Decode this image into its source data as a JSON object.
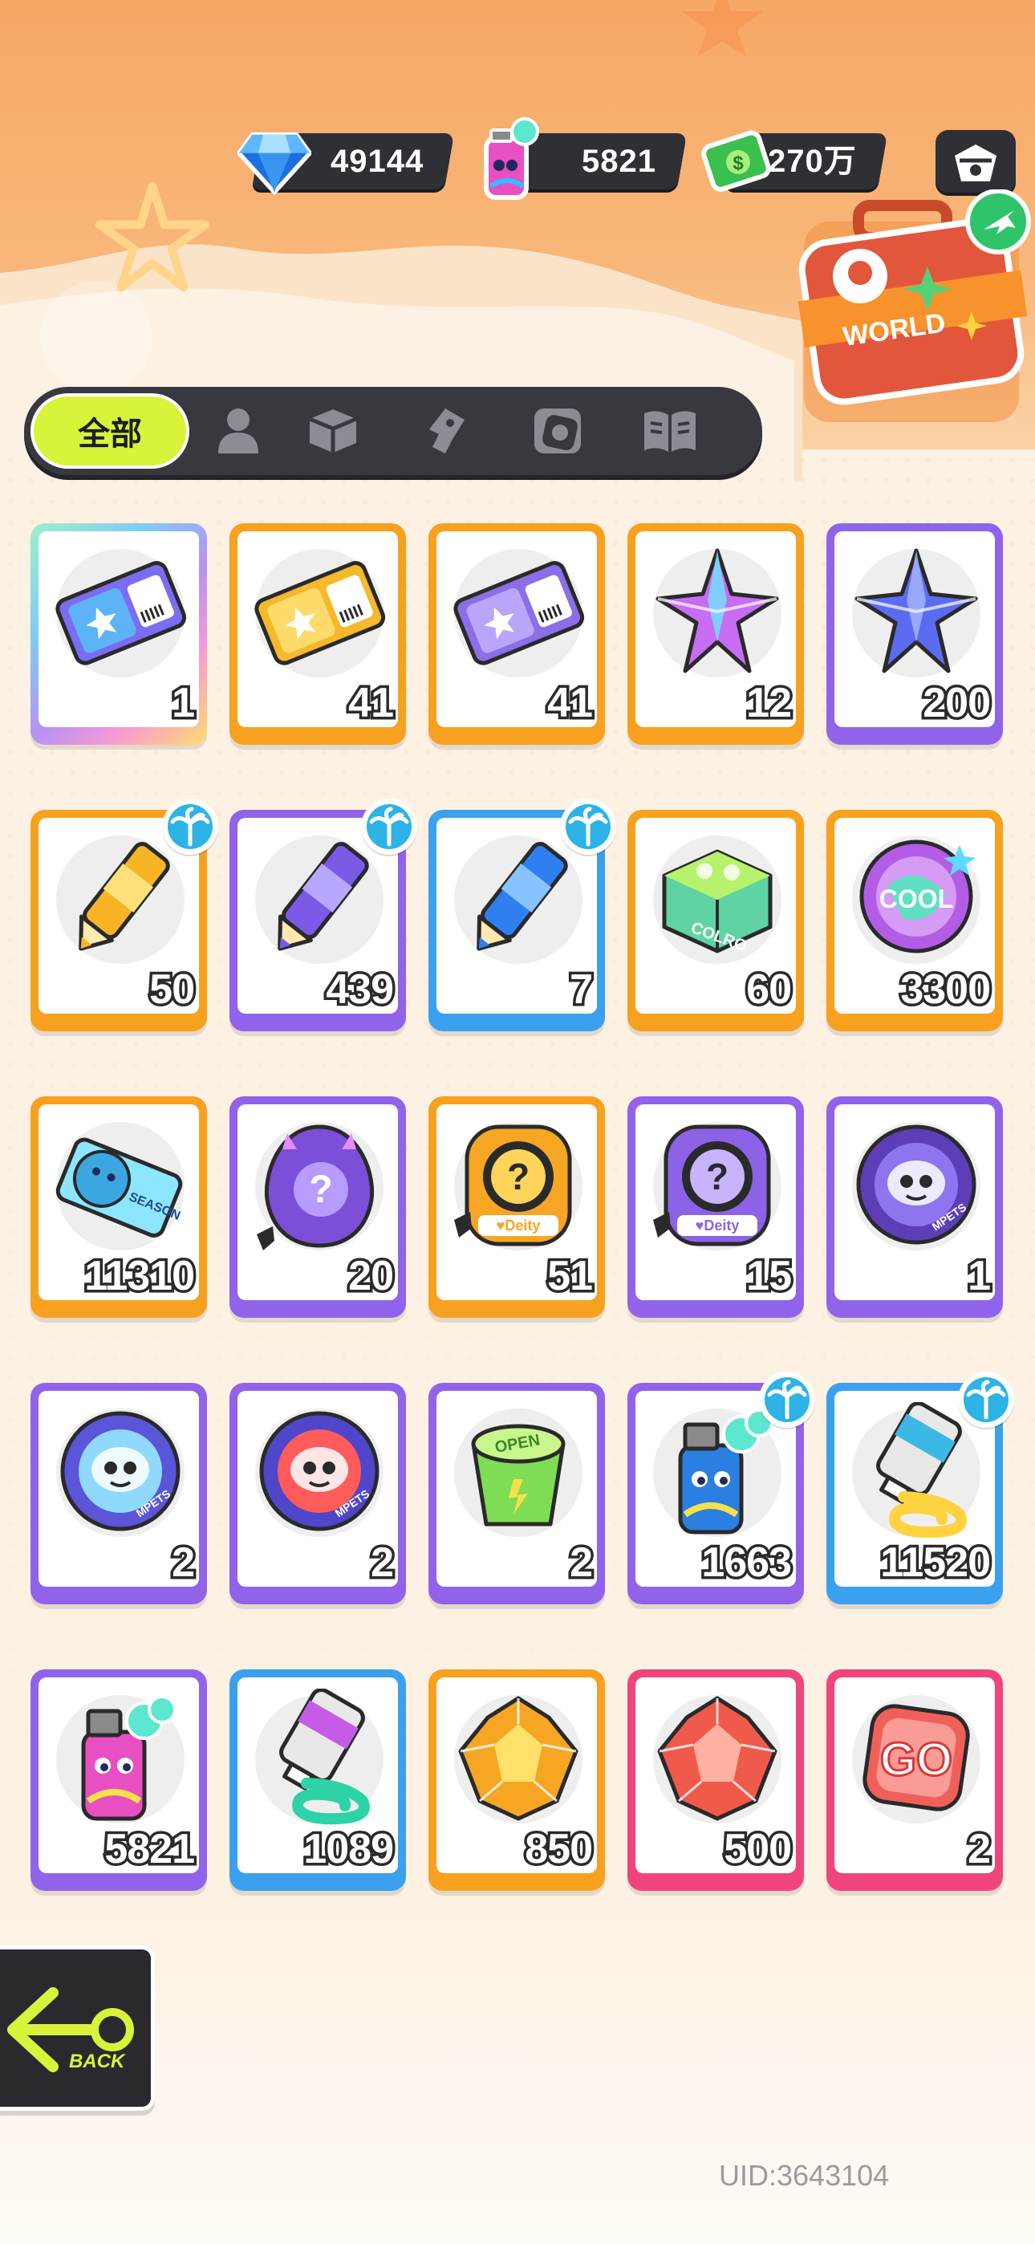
{
  "currency": {
    "diamonds": "49144",
    "spray_paint": "5821",
    "cash": "270万"
  },
  "world_button": {
    "label": "WORLD"
  },
  "tabs": [
    {
      "label": "全部",
      "active": true,
      "icon": "all"
    },
    {
      "label": "",
      "icon": "person-icon"
    },
    {
      "label": "",
      "icon": "box-icon"
    },
    {
      "label": "",
      "icon": "spray-gun-icon"
    },
    {
      "label": "",
      "icon": "sticker-icon"
    },
    {
      "label": "",
      "icon": "book-icon"
    }
  ],
  "items": [
    {
      "name": "rainbow-ticket",
      "count": "1",
      "frame": "rainbow",
      "icon": "ticket-icon"
    },
    {
      "name": "gold-ticket",
      "count": "41",
      "frame": "orange",
      "icon": "ticket-icon"
    },
    {
      "name": "purple-ticket",
      "count": "41",
      "frame": "orange",
      "icon": "ticket-icon"
    },
    {
      "name": "rainbow-star-crystal",
      "count": "12",
      "frame": "orange",
      "icon": "star-crystal-icon"
    },
    {
      "name": "blue-star-crystal",
      "count": "200",
      "frame": "purple",
      "icon": "star-crystal-icon"
    },
    {
      "name": "yellow-crayon",
      "count": "50",
      "frame": "orange",
      "icon": "crayon-icon",
      "badge": true
    },
    {
      "name": "purple-crayon",
      "count": "439",
      "frame": "purple",
      "icon": "crayon-icon",
      "badge": true
    },
    {
      "name": "blue-crayon",
      "count": "7",
      "frame": "blue",
      "icon": "crayon-icon",
      "badge": true
    },
    {
      "name": "color-block",
      "count": "60",
      "frame": "orange",
      "icon": "block-icon"
    },
    {
      "name": "cool-badge",
      "count": "3300",
      "frame": "orange",
      "icon": "badge-icon"
    },
    {
      "name": "season-ticket",
      "count": "11310",
      "frame": "orange",
      "icon": "season-ticket-icon"
    },
    {
      "name": "mystery-egg",
      "count": "20",
      "frame": "purple",
      "icon": "egg-icon"
    },
    {
      "name": "deity-mystery-gold",
      "count": "51",
      "frame": "orange",
      "icon": "mystery-icon"
    },
    {
      "name": "deity-mystery-purple",
      "count": "15",
      "frame": "purple",
      "icon": "mystery-icon"
    },
    {
      "name": "pet-ball-cat",
      "count": "1",
      "frame": "purple",
      "icon": "pet-ball-icon"
    },
    {
      "name": "pet-ball-fish",
      "count": "2",
      "frame": "purple",
      "icon": "pet-ball-icon"
    },
    {
      "name": "pet-ball-shark",
      "count": "2",
      "frame": "purple",
      "icon": "pet-ball-icon"
    },
    {
      "name": "open-cup",
      "count": "2",
      "frame": "purple",
      "icon": "cup-icon"
    },
    {
      "name": "spray-can-blue",
      "count": "1663",
      "frame": "purple",
      "icon": "spray-can-icon",
      "badge": true
    },
    {
      "name": "paint-tube-green",
      "count": "11520",
      "frame": "blue",
      "icon": "paint-tube-icon",
      "badge": true
    },
    {
      "name": "spray-can-pink",
      "count": "5821",
      "frame": "purple",
      "icon": "spray-can-icon"
    },
    {
      "name": "paint-tube-rainbow",
      "count": "1089",
      "frame": "blue",
      "icon": "paint-tube-icon"
    },
    {
      "name": "gold-gem",
      "count": "850",
      "frame": "orange",
      "icon": "gem-icon"
    },
    {
      "name": "red-gem",
      "count": "500",
      "frame": "pink",
      "icon": "gem-icon"
    },
    {
      "name": "go-dice",
      "count": "2",
      "frame": "pink",
      "icon": "dice-icon"
    }
  ],
  "back_label": "BACK",
  "uid": "UID:3643104",
  "colors": {
    "orange": "#f7a11f",
    "purple": "#9163ea",
    "blue": "#3ba1ee",
    "pink": "#f0457c",
    "accent": "#d9f33b",
    "dark": "#2f2f36"
  }
}
